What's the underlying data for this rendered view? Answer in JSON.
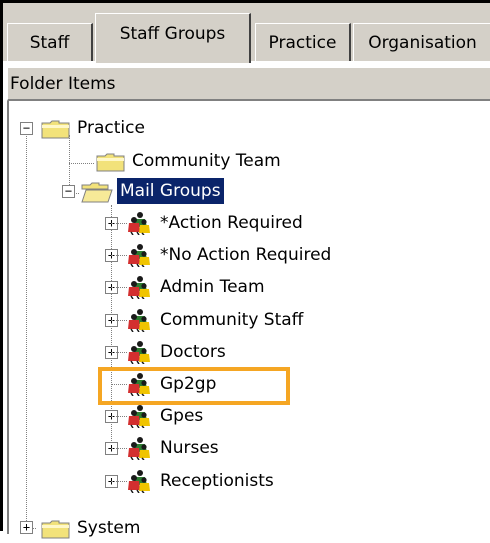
{
  "tabs": [
    {
      "label": "Staff"
    },
    {
      "label": "Staff Groups"
    },
    {
      "label": "Practice"
    },
    {
      "label": "Organisation"
    }
  ],
  "folder_header": "Folder Items",
  "tree": {
    "practice": "Practice",
    "community_team": "Community Team",
    "mail_groups": "Mail Groups",
    "groups": [
      "*Action Required",
      "*No Action Required",
      "Admin Team",
      "Community Staff",
      "Doctors",
      "Gp2gp",
      "Gpes",
      "Nurses",
      "Receptionists"
    ],
    "system": "System"
  },
  "colors": {
    "accent_highlight": "#f5a623",
    "selection": "#0a246a",
    "folder": "#f2e27a"
  }
}
